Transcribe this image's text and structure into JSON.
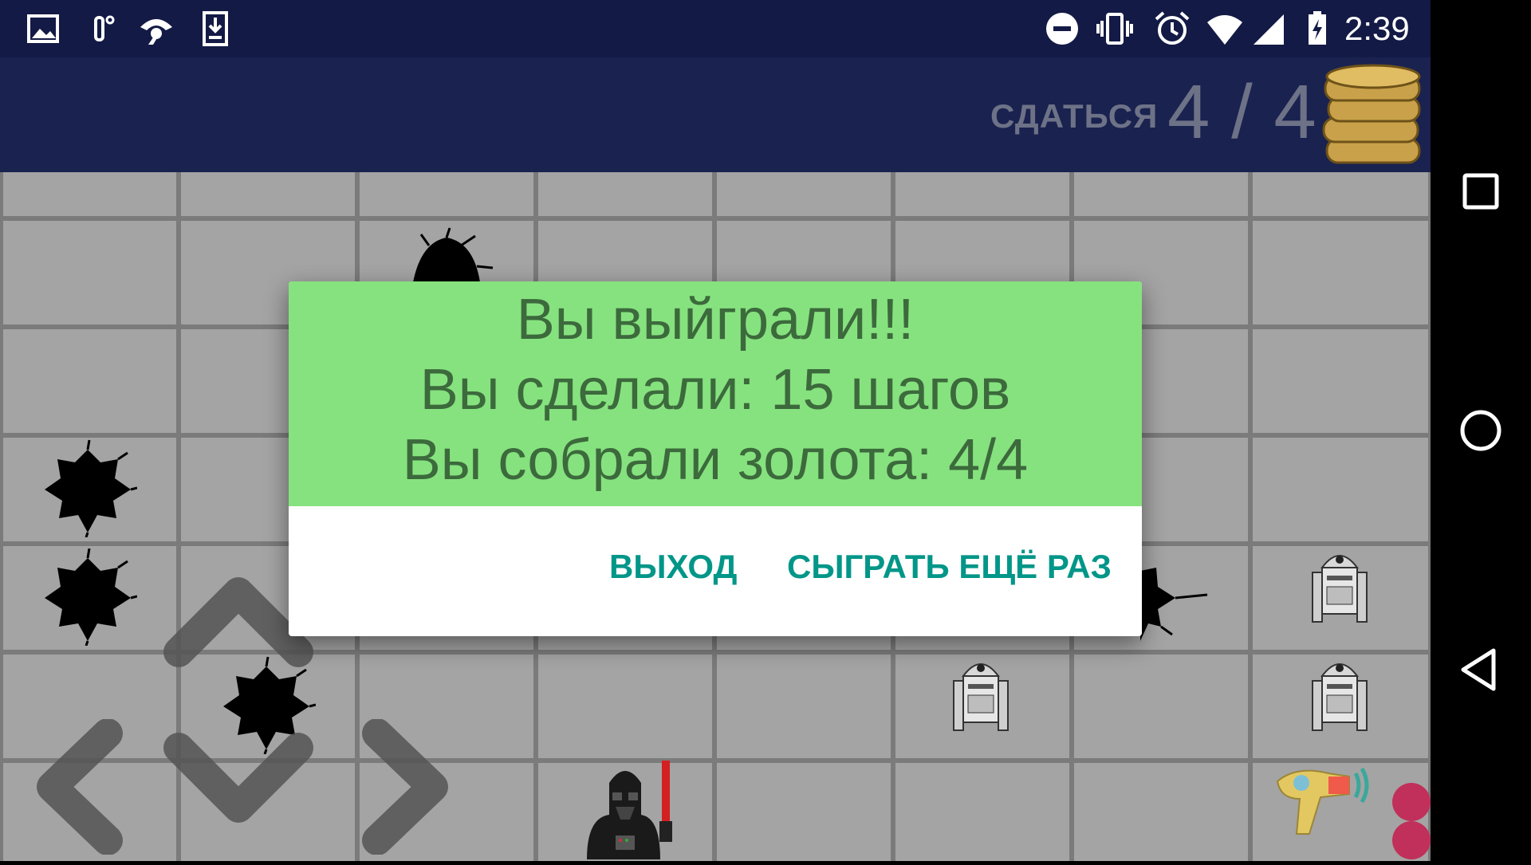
{
  "status_bar": {
    "time": "2:39",
    "left_icons": [
      "image-icon",
      "temperature-icon",
      "hotspot-icon",
      "download-icon"
    ],
    "right_icons": [
      "do-not-disturb-icon",
      "vibrate-icon",
      "alarm-icon",
      "wifi-icon",
      "cell-signal-icon",
      "battery-charging-icon"
    ]
  },
  "app_bar": {
    "surrender_label": "СДАТЬСЯ",
    "score": "4 / 4",
    "coins_icon": "gold-coins-icon"
  },
  "dialog": {
    "line1": "Вы выйграли!!!",
    "line2": "Вы сделали: 15 шагов",
    "line3": "Вы собрали золота: 4/4",
    "exit_label": "ВЫХОД",
    "again_label": "СЫГРАТЬ ЕЩЁ РАЗ"
  },
  "colors": {
    "status_bar": "#131a45",
    "app_bar": "#1a2250",
    "board_cell": "#a4a4a4",
    "grid_line": "#111111",
    "dialog_header": "#86e27f",
    "dialog_text": "#3c6a3c",
    "button_text": "#009688",
    "muted_text": "#6d7287"
  },
  "board": {
    "columns": 8,
    "rows": 7,
    "sprites": [
      "crater-icon",
      "robot-icon",
      "dark-helmet-player-icon",
      "ray-gun-icon"
    ]
  },
  "controls": [
    "dpad-up-icon",
    "dpad-down-icon",
    "dpad-left-icon",
    "dpad-right-icon"
  ],
  "nav_bar": [
    "recent-apps-button",
    "home-button",
    "back-button"
  ]
}
